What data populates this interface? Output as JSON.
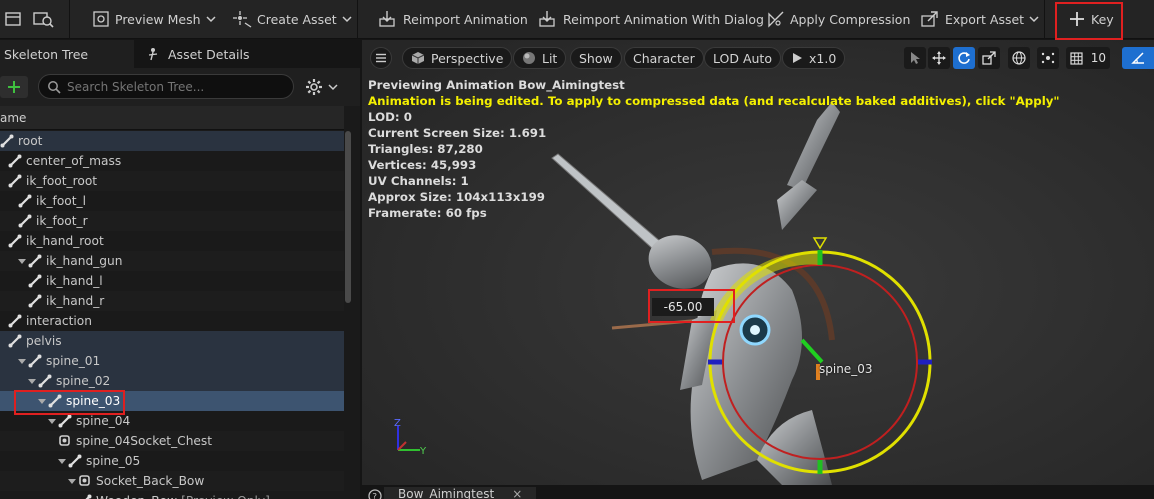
{
  "toolbar": {
    "preview_mesh": "Preview Mesh",
    "create_asset": "Create Asset",
    "reimport_animation": "Reimport Animation",
    "reimport_with_dialog": "Reimport Animation With Dialog",
    "apply_compression": "Apply Compression",
    "export_asset": "Export Asset",
    "key": "Key"
  },
  "left_panel": {
    "tabs": [
      "Skeleton Tree",
      "Asset Details"
    ],
    "search_placeholder": "Search Skeleton Tree...",
    "column_header": "ame",
    "tree": [
      {
        "label": "root"
      },
      {
        "label": "center_of_mass"
      },
      {
        "label": "ik_foot_root"
      },
      {
        "label": "ik_foot_l"
      },
      {
        "label": "ik_foot_r"
      },
      {
        "label": "ik_hand_root"
      },
      {
        "label": "ik_hand_gun"
      },
      {
        "label": "ik_hand_l"
      },
      {
        "label": "ik_hand_r"
      },
      {
        "label": "interaction"
      },
      {
        "label": "pelvis"
      },
      {
        "label": "spine_01"
      },
      {
        "label": "spine_02"
      },
      {
        "label": "spine_03"
      },
      {
        "label": "spine_04"
      },
      {
        "label": "spine_04Socket_Chest"
      },
      {
        "label": "spine_05"
      },
      {
        "label": "Socket_Back_Bow"
      },
      {
        "label": "Wooden_Bow",
        "suffix": "[Preview Only]"
      }
    ]
  },
  "viewport": {
    "toolbar": {
      "perspective": "Perspective",
      "lit": "Lit",
      "show": "Show",
      "character": "Character",
      "lod": "LOD Auto",
      "play_rate": "x1.0",
      "grid_size": "10"
    },
    "overlay": {
      "previewing": "Previewing Animation Bow_Aimingtest",
      "warning": "Animation is being edited. To apply to compressed data (and recalculate baked additives), click \"Apply\"",
      "lod": "LOD: 0",
      "screen_size": "Current Screen Size: 1.691",
      "triangles": "Triangles: 87,280",
      "vertices": "Vertices: 45,993",
      "uv_channels": "UV Channels: 1",
      "approx_size": "Approx Size: 104x113x199",
      "framerate": "Framerate: 60 fps"
    },
    "rotation_value": "-65.00",
    "bone_label": "spine_03",
    "axis_z": "Z",
    "axis_y": "Y"
  },
  "bottom": {
    "tab": "Bow_Aimingtest"
  },
  "colors": {
    "accent_blue": "#1e6fd0",
    "highlight_red": "#e02020",
    "warning_yellow": "#f4f000",
    "selected_row": "#3d5470"
  },
  "icons": [
    "skeleton-tree-icon",
    "asset-details-icon",
    "preview-mesh-icon",
    "create-asset-icon",
    "reimport-icon",
    "compression-icon",
    "export-icon",
    "plus-icon",
    "search-icon",
    "gear-icon",
    "bone-icon",
    "socket-icon",
    "hamburger-icon",
    "perspective-cube-icon",
    "lit-sphere-icon",
    "play-icon",
    "select-arrow-icon",
    "move-icon",
    "rotate-icon",
    "scale-icon",
    "globe-icon",
    "snap-icon",
    "grid-icon",
    "angle-icon"
  ]
}
